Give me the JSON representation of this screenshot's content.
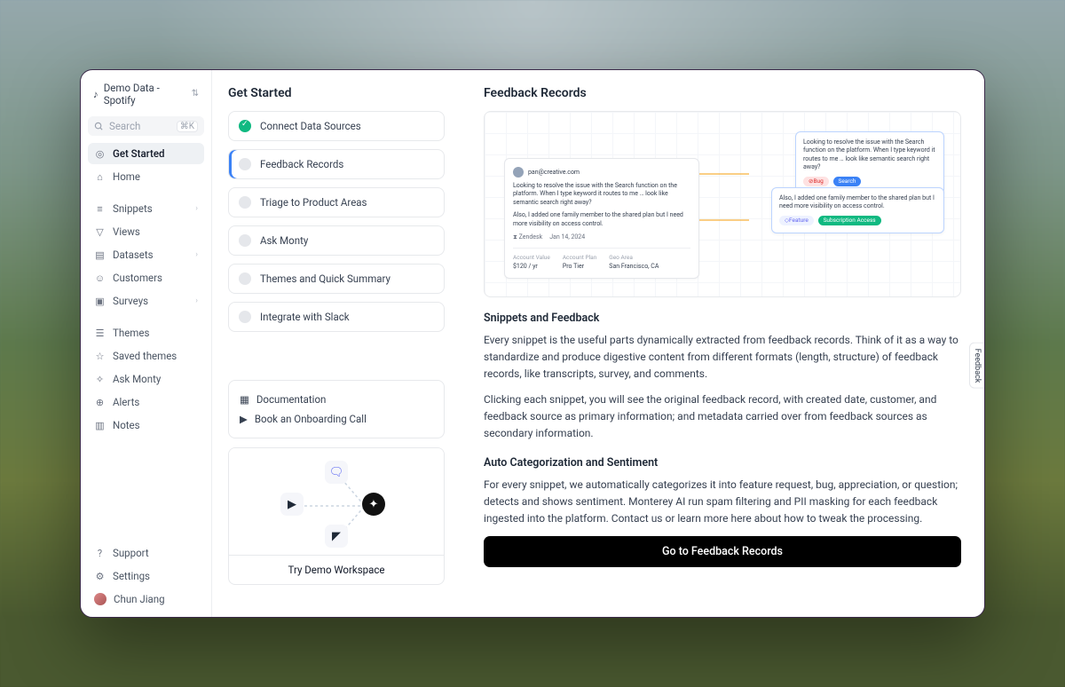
{
  "workspace": {
    "name": "Demo Data - Spotify"
  },
  "search": {
    "placeholder": "Search",
    "shortcut": "⌘K"
  },
  "nav": {
    "get_started": "Get Started",
    "home": "Home",
    "snippets": "Snippets",
    "views": "Views",
    "datasets": "Datasets",
    "customers": "Customers",
    "surveys": "Surveys",
    "themes": "Themes",
    "saved_themes": "Saved themes",
    "ask_monty": "Ask Monty",
    "alerts": "Alerts",
    "notes": "Notes"
  },
  "footer": {
    "support": "Support",
    "settings": "Settings",
    "user": "Chun Jiang"
  },
  "left": {
    "title": "Get Started",
    "steps": {
      "connect": "Connect Data Sources",
      "feedback": "Feedback Records",
      "triage": "Triage to Product Areas",
      "ask": "Ask Monty",
      "themes": "Themes and Quick Summary",
      "slack": "Integrate with Slack"
    },
    "aux": {
      "docs": "Documentation",
      "onboard": "Book an Onboarding Call"
    },
    "try": "Try Demo Workspace"
  },
  "right": {
    "title": "Feedback Records",
    "illus": {
      "email": "pan@creative.com",
      "body1": "Looking to resolve the issue with the Search function on the platform. When I type keyword it routes to me … look like semantic search right away?",
      "body2": "Also, I added one family member to the shared plan but I need more visibility on access control.",
      "source": "Zendesk",
      "date": "Jan 14, 2024",
      "m1_lbl": "Account Value",
      "m1_val": "$120 / yr",
      "m2_lbl": "Account Plan",
      "m2_val": "Pro Tier",
      "m3_lbl": "Geo Area",
      "m3_val": "San Francisco, CA",
      "s1_text": "Looking to resolve the issue with the Search function on the platform. When I type keyword it routes to me … look like semantic search right away?",
      "s1_chip1": "Bug",
      "s1_chip2": "Search",
      "s2_text": "Also, I added one family member to the shared plan but I need more visibility on access control.",
      "s2_chip1": "Feature",
      "s2_chip2": "Subscription Access"
    },
    "h_snip": "Snippets and Feedback",
    "p1": "Every snippet is the useful parts dynamically extracted from feedback records. Think of it as a way to standardize and produce digestive content from different formats (length, structure) of feedback records, like transcripts, survey, and comments.",
    "p2": "Clicking each snippet, you will see the original feedback record, with created date, customer, and feedback source as primary information; and metadata carried over from feedback sources as secondary information.",
    "h_auto": "Auto Categorization and Sentiment",
    "p3": "For every snippet, we automatically categorizes it into feature request, bug, appreciation, or question; detects and shows sentiment. Monterey AI run spam filtering and PII masking for each feedback ingested into the platform. Contact us or learn more here about how to tweak the processing.",
    "cta": "Go to Feedback Records"
  },
  "tab": {
    "feedback": "Feedback"
  }
}
